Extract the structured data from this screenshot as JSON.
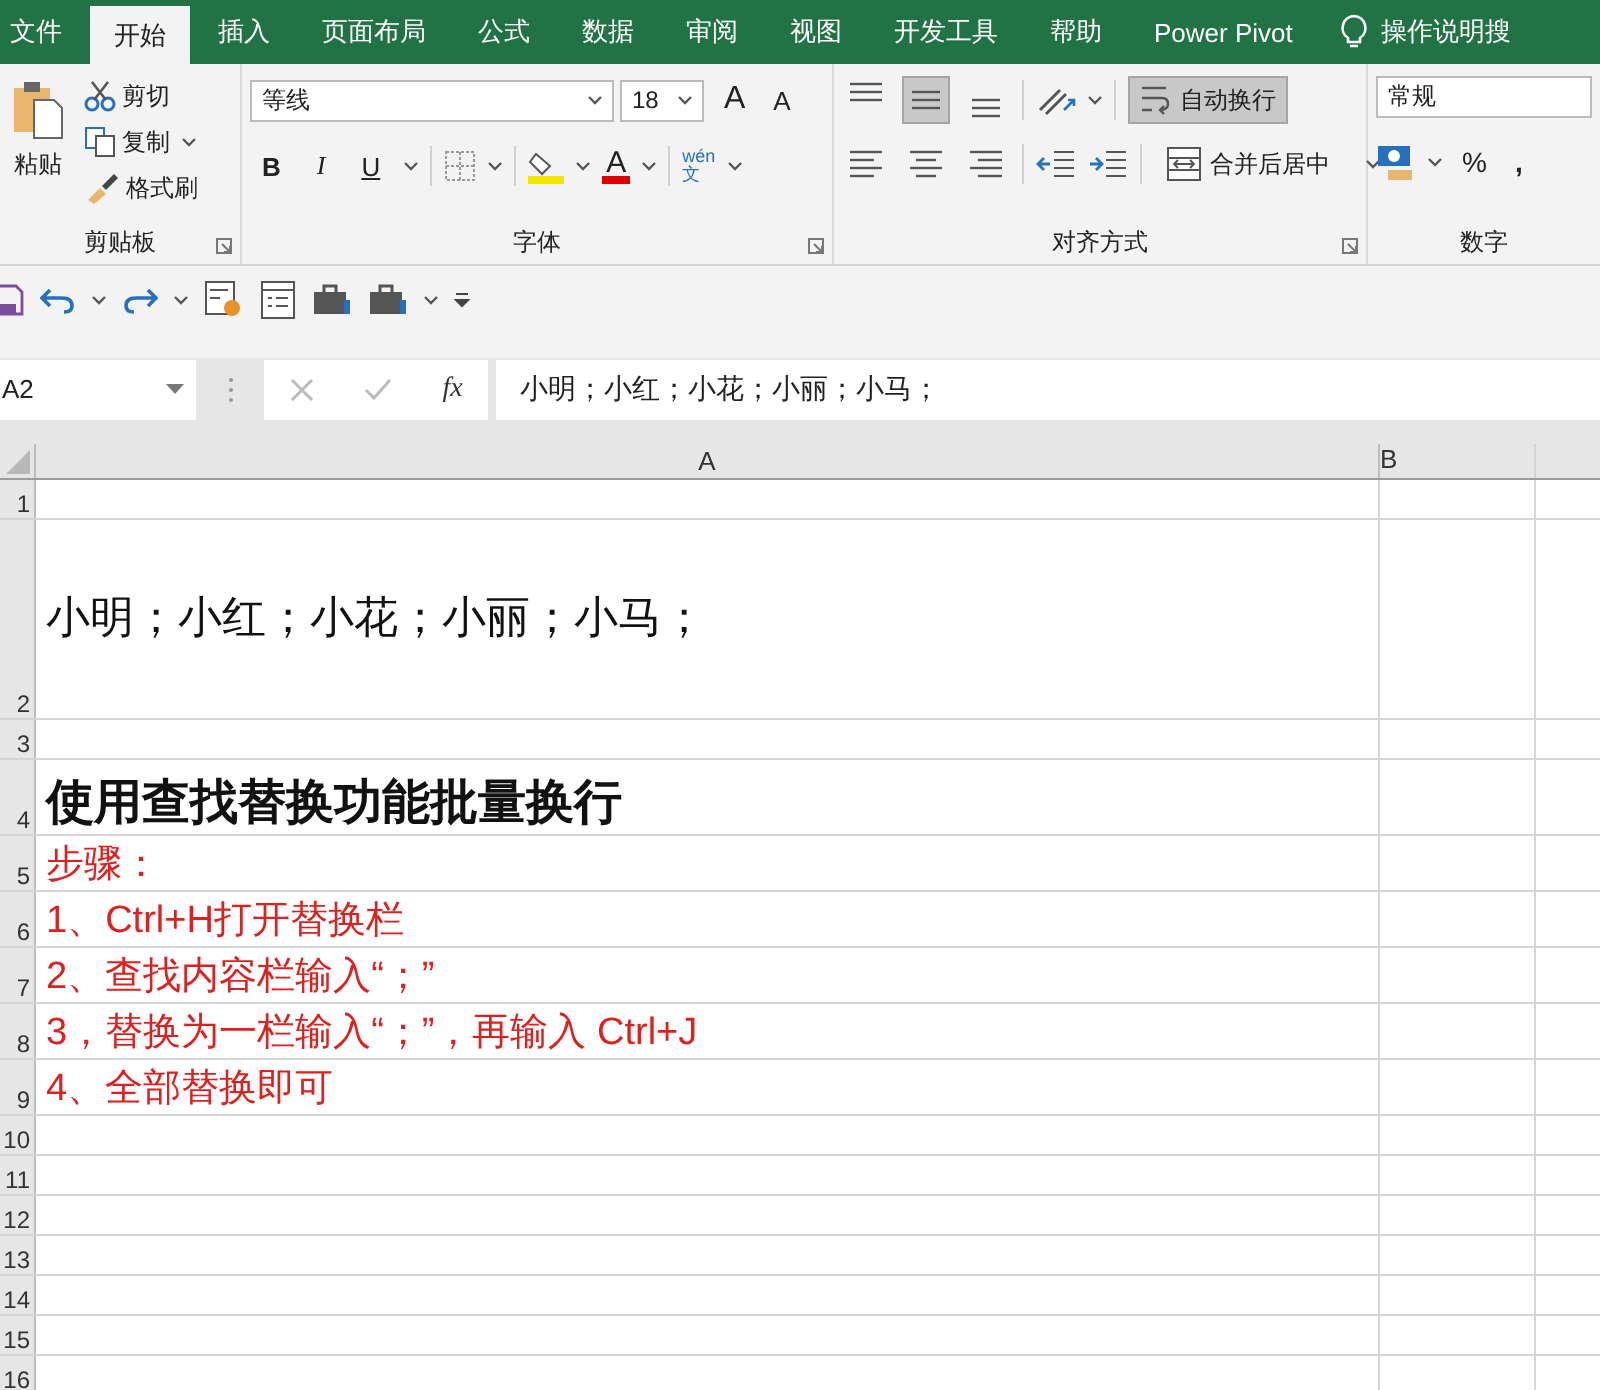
{
  "tabs": [
    {
      "label": "文件",
      "selected": false
    },
    {
      "label": "开始",
      "selected": true
    },
    {
      "label": "插入",
      "selected": false
    },
    {
      "label": "页面布局",
      "selected": false
    },
    {
      "label": "公式",
      "selected": false
    },
    {
      "label": "数据",
      "selected": false
    },
    {
      "label": "审阅",
      "selected": false
    },
    {
      "label": "视图",
      "selected": false
    },
    {
      "label": "开发工具",
      "selected": false
    },
    {
      "label": "帮助",
      "selected": false
    },
    {
      "label": "Power Pivot",
      "selected": false
    }
  ],
  "tell_me": {
    "label": "操作说明搜"
  },
  "ribbon": {
    "clipboard": {
      "paste": "粘贴",
      "cut": "剪切",
      "copy": "复制",
      "format_painter": "格式刷",
      "label": "剪贴板"
    },
    "font": {
      "name": "等线",
      "size": "18",
      "grow": "A",
      "shrink": "A",
      "styles": [
        {
          "label": "B",
          "kind": "bold"
        },
        {
          "label": "I",
          "kind": "italic"
        },
        {
          "label": "U",
          "kind": "underline"
        }
      ],
      "font_color": "A",
      "phonetic_top": "wén",
      "phonetic_bottom": "文",
      "label": "字体"
    },
    "alignment": {
      "vertical": [
        {
          "kind": "top",
          "selected": false
        },
        {
          "kind": "middle",
          "selected": true
        },
        {
          "kind": "bottom",
          "selected": false
        }
      ],
      "horizontal": [
        {
          "kind": "left",
          "selected": false
        },
        {
          "kind": "center",
          "selected": false
        },
        {
          "kind": "right",
          "selected": false
        }
      ],
      "wrap_text": {
        "label": "自动换行",
        "on": true
      },
      "merge": "合并后居中",
      "label": "对齐方式"
    },
    "number": {
      "format": "常规",
      "percent": "%",
      "comma": ",",
      "label": "数字"
    }
  },
  "formula_bar": {
    "name_box": "A2",
    "fx": "fx",
    "content": "小明；小红；小花；小丽；小马；"
  },
  "columns": [
    "A",
    "B"
  ],
  "rows": [
    {
      "header": "1",
      "kind": "blank"
    },
    {
      "header": "2",
      "kind": "large",
      "cell": "小明；小红；小花；小丽；小马；"
    },
    {
      "header": "3",
      "kind": "blank"
    },
    {
      "header": "4",
      "kind": "heading",
      "cell": "使用查找替换功能批量换行"
    },
    {
      "header": "5",
      "kind": "step",
      "cell": "步骤："
    },
    {
      "header": "6",
      "kind": "step",
      "cell": "1、Ctrl+H打开替换栏"
    },
    {
      "header": "7",
      "kind": "step",
      "cell": "2、查找内容栏输入“；”"
    },
    {
      "header": "8",
      "kind": "step",
      "cell": "3，替换为一栏输入“；”，再输入 Ctrl+J"
    },
    {
      "header": "9",
      "kind": "step",
      "cell": "4、全部替换即可"
    },
    {
      "header": "10",
      "kind": "blank"
    },
    {
      "header": "11",
      "kind": "blank"
    },
    {
      "header": "12",
      "kind": "blank"
    },
    {
      "header": "13",
      "kind": "blank"
    },
    {
      "header": "14",
      "kind": "blank"
    },
    {
      "header": "15",
      "kind": "blank"
    },
    {
      "header": "16",
      "kind": "blank"
    }
  ]
}
